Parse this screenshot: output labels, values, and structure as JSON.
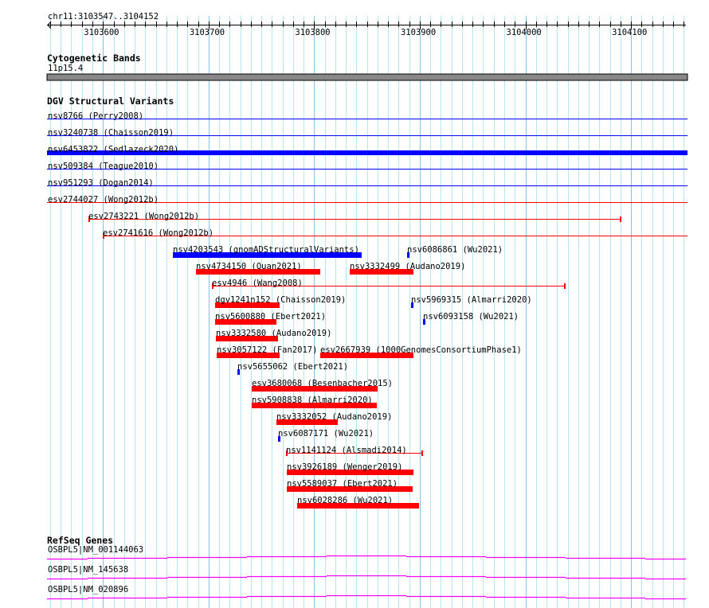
{
  "view": {
    "label": "chr11:3103547..3104152",
    "start": 3103547,
    "end": 3104152,
    "ticks": [
      3103600,
      3103700,
      3103800,
      3103900,
      3104000,
      3104100
    ]
  },
  "colors": {
    "minor_grid": "#b4e6f0",
    "major_grid": "#80c4e8",
    "red": "#ff0000",
    "blue": "#0000ff",
    "gene": "#ff00ff",
    "band": "#888888"
  },
  "cytoband": {
    "title": "Cytogenetic Bands",
    "band": "11p15.4"
  },
  "dgv": {
    "title": "DGV Structural Variants",
    "features": [
      {
        "label": "nsv8766 (Perry2008)",
        "start": 3103547,
        "end": 3104200,
        "color": "blue",
        "style": "line",
        "row": 0
      },
      {
        "label": "nsv3240738 (Chaisson2019)",
        "start": 3103547,
        "end": 3104200,
        "color": "blue",
        "style": "line",
        "row": 1
      },
      {
        "label": "nsv6453822 (Sedlazeck2020)",
        "start": 3103547,
        "end": 3104200,
        "color": "blue",
        "style": "bar",
        "row": 2
      },
      {
        "label": "nsv509384 (Teague2010)",
        "start": 3103547,
        "end": 3104200,
        "color": "blue",
        "style": "line",
        "row": 3
      },
      {
        "label": "nsv951293 (Dogan2014)",
        "start": 3103547,
        "end": 3104200,
        "color": "blue",
        "style": "line",
        "row": 4
      },
      {
        "label": "esv2744027 (Wong2012b)",
        "start": 3103547,
        "end": 3104200,
        "color": "red",
        "style": "line",
        "row": 5
      },
      {
        "label": "esv2743221 (Wong2012b)",
        "start": 3103586,
        "end": 3104090,
        "color": "red",
        "style": "span",
        "row": 6
      },
      {
        "label": "esv2741616 (Wong2012b)",
        "start": 3103600,
        "end": 3104200,
        "color": "red",
        "style": "span",
        "row": 7
      },
      {
        "label": "nsv4203543 (gnomADStructuralVariants)",
        "start": 3103666,
        "end": 3103845,
        "color": "blue",
        "style": "bar",
        "row": 8
      },
      {
        "label": "nsv6086861 (Wu2021)",
        "start": 3103888,
        "end": 3103890,
        "color": "blue",
        "style": "bar",
        "row": 8
      },
      {
        "label": "nsv4734150 (Quan2021)",
        "start": 3103688,
        "end": 3103806,
        "color": "red",
        "style": "bar",
        "row": 9
      },
      {
        "label": "nsv3332499 (Audano2019)",
        "start": 3103834,
        "end": 3103894,
        "color": "red",
        "style": "bar",
        "row": 9
      },
      {
        "label": "esv4946 (Wang2008)",
        "start": 3103703,
        "end": 3104037,
        "color": "red",
        "style": "span",
        "row": 10
      },
      {
        "label": "dgv1241n152 (Chaisson2019)",
        "start": 3103706,
        "end": 3103767,
        "color": "red",
        "style": "bar",
        "row": 11
      },
      {
        "label": "nsv5969315 (Almarri2020)",
        "start": 3103892,
        "end": 3103894,
        "color": "blue",
        "style": "bar",
        "row": 11
      },
      {
        "label": "nsv5600880 (Ebert2021)",
        "start": 3103706,
        "end": 3103764,
        "color": "red",
        "style": "bar",
        "row": 12
      },
      {
        "label": "nsv6093158 (Wu2021)",
        "start": 3103903,
        "end": 3103905,
        "color": "blue",
        "style": "bar",
        "row": 12
      },
      {
        "label": "nsv3332580 (Audano2019)",
        "start": 3103707,
        "end": 3103766,
        "color": "red",
        "style": "bar",
        "row": 13
      },
      {
        "label": "nsv3057122 (Fan2017)",
        "start": 3103708,
        "end": 3103767,
        "color": "red",
        "style": "bar",
        "row": 14
      },
      {
        "label": "esv2667939 (1000GenomesConsortiumPhase1)",
        "start": 3103806,
        "end": 3103894,
        "color": "red",
        "style": "bar",
        "row": 14
      },
      {
        "label": "nsv5655062 (Ebert2021)",
        "start": 3103727,
        "end": 3103729,
        "color": "blue",
        "style": "bar",
        "row": 15
      },
      {
        "label": "esv3680068 (Besenbacher2015)",
        "start": 3103741,
        "end": 3103860,
        "color": "red",
        "style": "bar",
        "row": 16
      },
      {
        "label": "nsv5908838 (Almarri2020)",
        "start": 3103741,
        "end": 3103859,
        "color": "red",
        "style": "bar",
        "row": 17
      },
      {
        "label": "nsv3332052 (Audano2019)",
        "start": 3103764,
        "end": 3103822,
        "color": "red",
        "style": "bar",
        "row": 18
      },
      {
        "label": "nsv6087171 (Wu2021)",
        "start": 3103766,
        "end": 3103768,
        "color": "blue",
        "style": "bar",
        "row": 19
      },
      {
        "label": "nsv1141124 (Alsmadi2014)",
        "start": 3103773,
        "end": 3103902,
        "color": "red",
        "style": "span",
        "row": 20
      },
      {
        "label": "nsv3926189 (Wenger2019)",
        "start": 3103774,
        "end": 3103894,
        "color": "red",
        "style": "bar",
        "row": 21
      },
      {
        "label": "nsv5589037 (Ebert2021)",
        "start": 3103774,
        "end": 3103893,
        "color": "red",
        "style": "bar",
        "row": 22
      },
      {
        "label": "nsv6028286 (Wu2021)",
        "start": 3103784,
        "end": 3103899,
        "color": "red",
        "style": "bar",
        "row": 23
      }
    ]
  },
  "refseq": {
    "title": "RefSeq Genes",
    "genes": [
      "OSBPL5|NM_001144063",
      "OSBPL5|NM_145638",
      "OSBPL5|NM_020896"
    ]
  }
}
